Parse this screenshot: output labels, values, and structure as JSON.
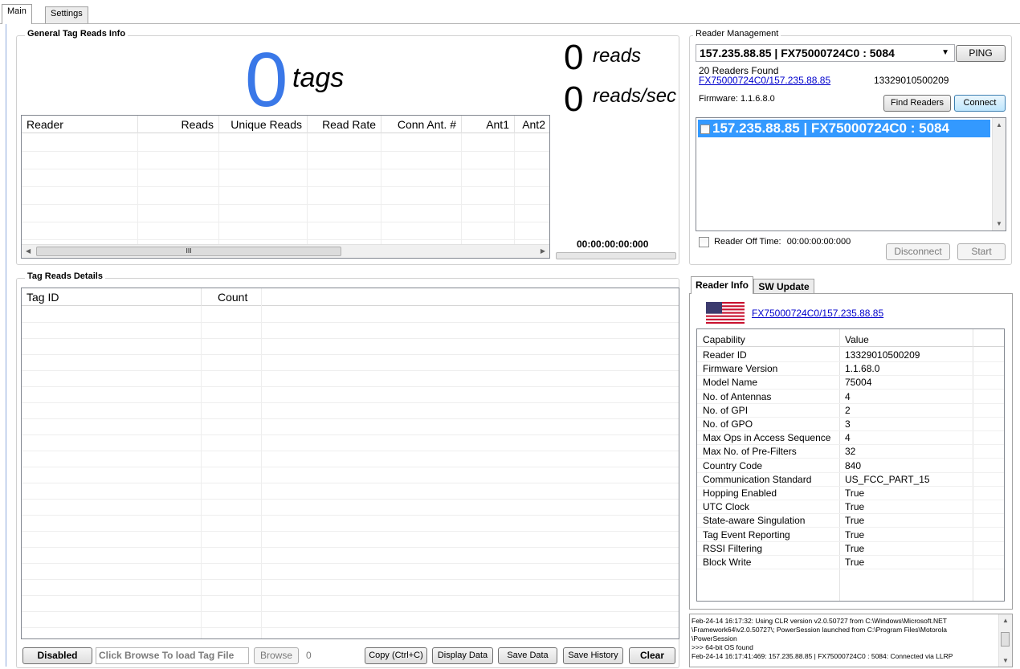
{
  "tabs": [
    "Main",
    "Settings"
  ],
  "general": {
    "legend": "General Tag Reads Info",
    "tag_count": "0",
    "tags_label": "tags",
    "reads_count": "0",
    "reads_label": "reads",
    "rate_count": "0",
    "rate_label": "reads/sec",
    "elapsed": "00:00:00:00:000",
    "columns": [
      "Reader",
      "Reads",
      "Unique Reads",
      "Read Rate",
      "Conn Ant. #",
      "Ant1",
      "Ant2"
    ],
    "scroll_grip": "III"
  },
  "reader_mgmt": {
    "legend": "Reader Management",
    "selected_reader": "157.235.88.85  |  FX75000724C0 : 5084",
    "ping_label": "PING",
    "readers_found": "20 Readers Found",
    "reader_link": "FX75000724C0/157.235.88.85",
    "reader_serial": "13329010500209",
    "firmware": "Firmware: 1.1.6.8.0",
    "find_readers_label": "Find Readers",
    "connect_label": "Connect",
    "list_item": "157.235.88.85  |  FX75000724C0 : 5084",
    "off_time_label": "Reader Off Time:",
    "off_time": "00:00:00:00:000",
    "disconnect_label": "Disconnect",
    "start_label": "Start"
  },
  "tag_details": {
    "legend": "Tag Reads Details",
    "columns": [
      "Tag ID",
      "Count"
    ]
  },
  "bottom_bar": {
    "disabled_label": "Disabled",
    "file_placeholder": "Click Browse To load Tag File",
    "browse_label": "Browse",
    "count": "0",
    "copy_label": "Copy (Ctrl+C)",
    "display_label": "Display Data",
    "save_label": "Save Data",
    "history_label": "Save History",
    "clear_label": "Clear"
  },
  "reader_info": {
    "tabs": [
      "Reader Info",
      "SW Update"
    ],
    "link": "FX75000724C0/157.235.88.85",
    "headers": [
      "Capability",
      "Value"
    ],
    "rows": [
      [
        "Reader ID",
        "13329010500209"
      ],
      [
        "Firmware Version",
        "1.1.68.0"
      ],
      [
        "Model Name",
        "75004"
      ],
      [
        "No. of Antennas",
        "4"
      ],
      [
        "No. of GPI",
        "2"
      ],
      [
        "No. of GPO",
        "3"
      ],
      [
        "Max Ops in Access Sequence",
        "4"
      ],
      [
        "Max No. of Pre-Filters",
        "32"
      ],
      [
        "Country Code",
        "840"
      ],
      [
        "Communication Standard",
        "US_FCC_PART_15"
      ],
      [
        "Hopping Enabled",
        "True"
      ],
      [
        "UTC Clock",
        "True"
      ],
      [
        "State-aware Singulation",
        "True"
      ],
      [
        "Tag Event Reporting",
        "True"
      ],
      [
        "RSSI Filtering",
        "True"
      ],
      [
        "Block Write",
        "True"
      ]
    ]
  },
  "log": {
    "lines": [
      "Feb-24-14 16:17:32: Using CLR version v2.0.50727 from C:\\Windows\\Microsoft.NET",
      "\\Framework64\\v2.0.50727\\; PowerSession launched from C:\\Program Files\\Motorola",
      "\\PowerSession",
      ">>> 64-bit OS found",
      "Feb-24-14 16:17:41:469: 157.235.88.85 | FX75000724C0 : 5084: Connected via LLRP"
    ]
  }
}
